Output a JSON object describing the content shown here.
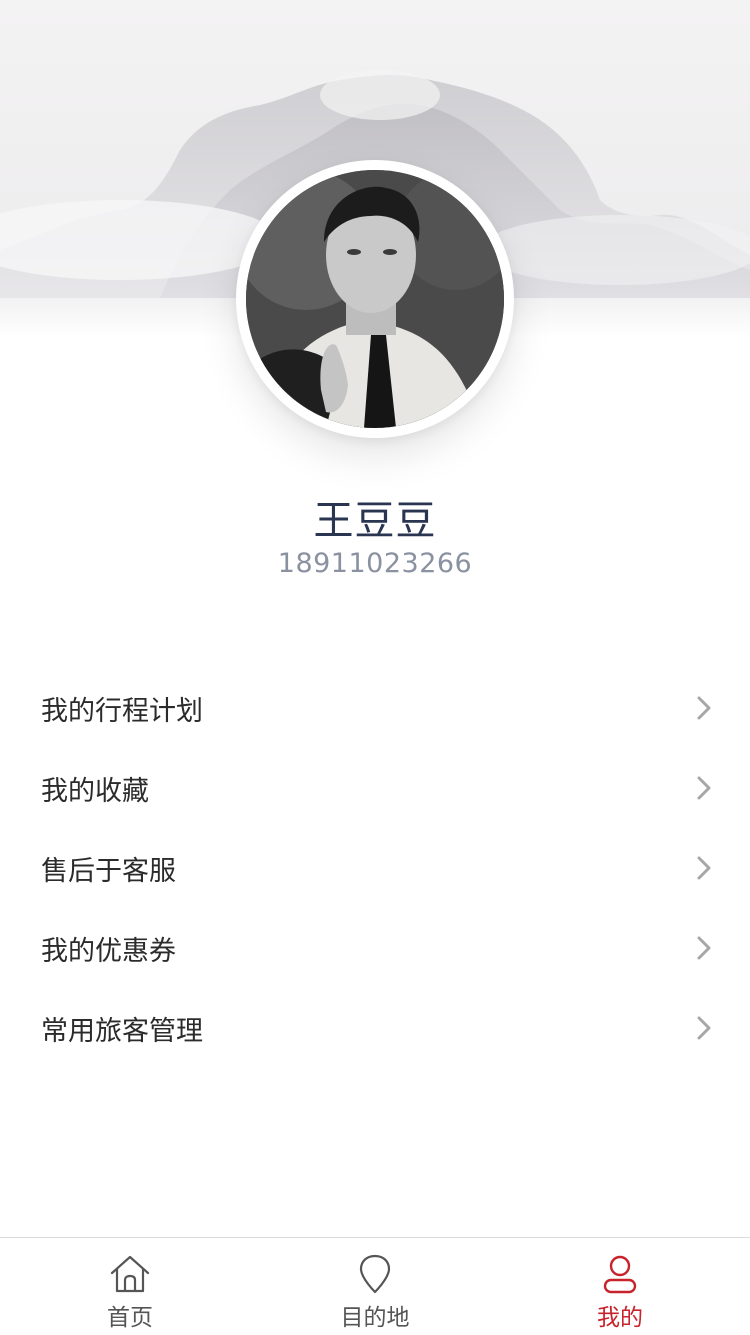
{
  "profile": {
    "name": "王豆豆",
    "phone": "18911023266"
  },
  "menu": [
    {
      "label": "我的行程计划",
      "icon": "chevron-right-icon"
    },
    {
      "label": "我的收藏",
      "icon": "chevron-right-icon"
    },
    {
      "label": "售后于客服",
      "icon": "chevron-right-icon"
    },
    {
      "label": "我的优惠券",
      "icon": "chevron-right-icon"
    },
    {
      "label": "常用旅客管理",
      "icon": "chevron-right-icon"
    }
  ],
  "tabbar": {
    "tabs": [
      {
        "label": "首页",
        "icon": "home-icon",
        "active": false
      },
      {
        "label": "目的地",
        "icon": "location-pin-icon",
        "active": false
      },
      {
        "label": "我的",
        "icon": "user-icon",
        "active": true
      }
    ],
    "colors": {
      "active": "#c8232c",
      "inactive": "#555555"
    }
  }
}
